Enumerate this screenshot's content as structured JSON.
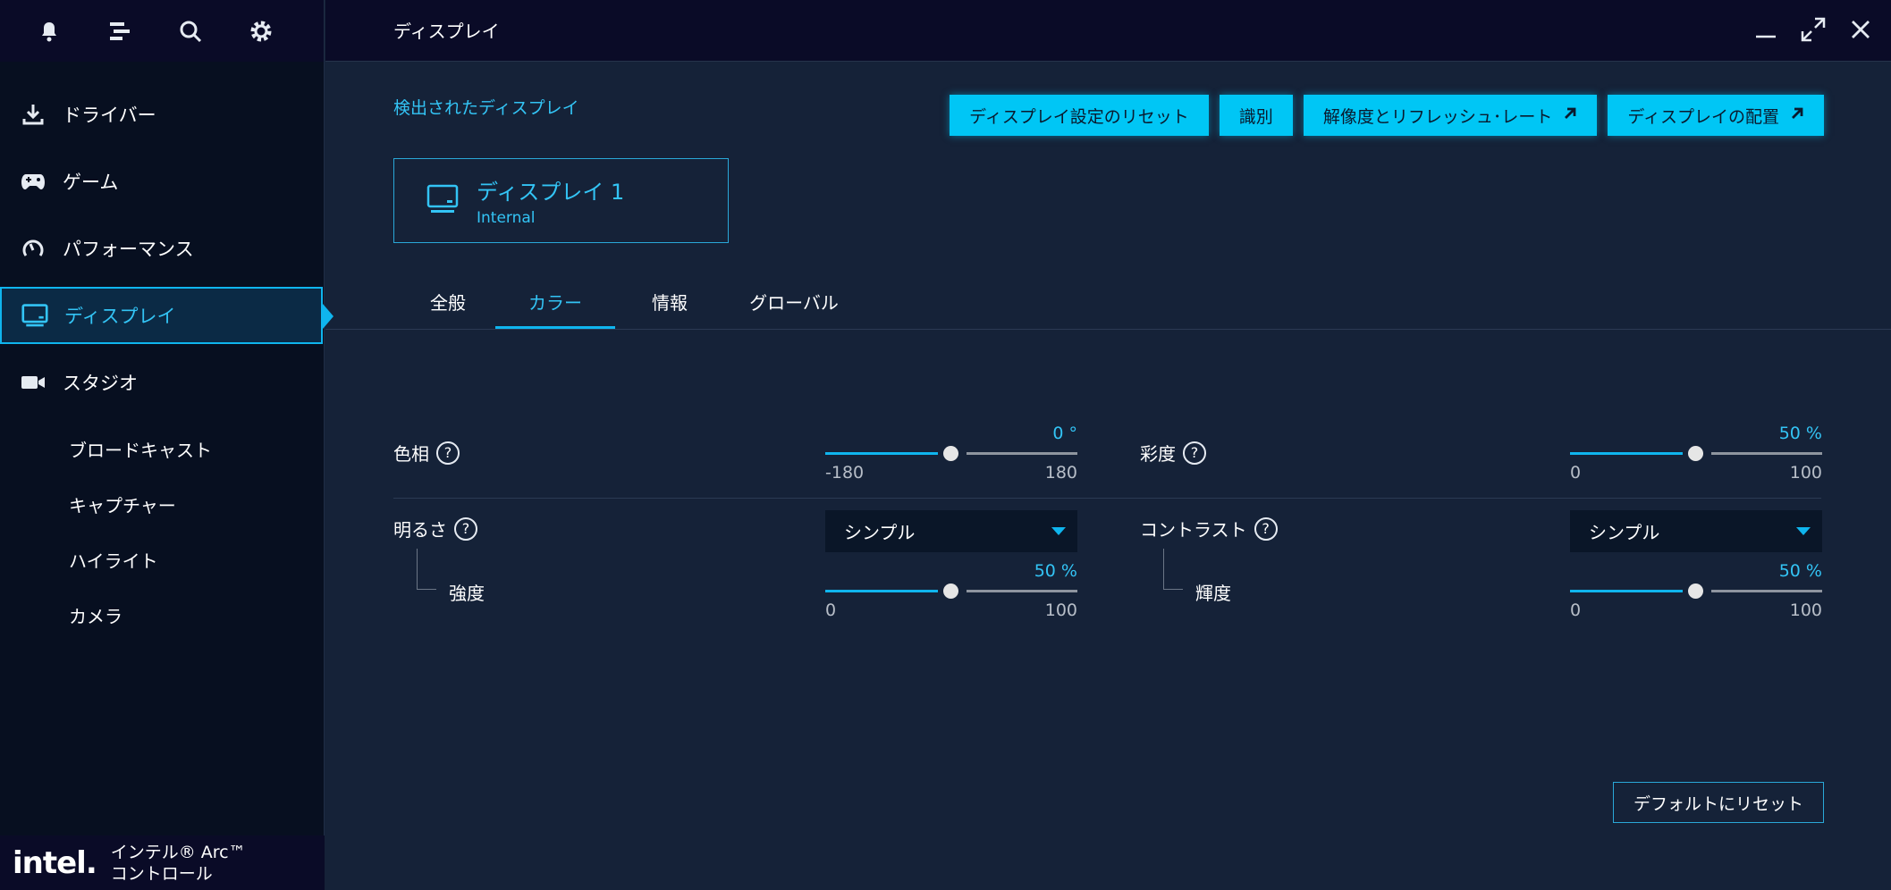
{
  "app": {
    "title": "ディスプレイ"
  },
  "brand": {
    "logo": "intel.",
    "line1": "インテル® Arc™",
    "line2": "コントロール"
  },
  "sidebar": {
    "top_icons": [
      "bell-icon",
      "list-icon",
      "search-icon",
      "gear-icon"
    ],
    "items": [
      {
        "label": "ドライバー",
        "icon": "download-icon"
      },
      {
        "label": "ゲーム",
        "icon": "gamepad-icon"
      },
      {
        "label": "パフォーマンス",
        "icon": "gauge-icon"
      },
      {
        "label": "ディスプレイ",
        "icon": "monitor-icon",
        "active": true
      },
      {
        "label": "スタジオ",
        "icon": "camera-icon"
      }
    ],
    "sub_items": [
      "ブロードキャスト",
      "キャプチャー",
      "ハイライト",
      "カメラ"
    ]
  },
  "header": {
    "detected_label": "検出されたディスプレイ",
    "buttons": [
      "ディスプレイ設定のリセット",
      "識別",
      "解像度とリフレッシュ･レート",
      "ディスプレイの配置"
    ]
  },
  "display_card": {
    "name": "ディスプレイ 1",
    "type": "Internal"
  },
  "tabs": [
    {
      "label": "全般"
    },
    {
      "label": "カラー",
      "active": true
    },
    {
      "label": "情報"
    },
    {
      "label": "グローバル"
    }
  ],
  "settings": {
    "hue": {
      "label": "色相",
      "value_text": "0 °",
      "value": 0,
      "min": "-180",
      "max": "180"
    },
    "saturation": {
      "label": "彩度",
      "value_text": "50 %",
      "value": 50,
      "min": "0",
      "max": "100"
    },
    "brightness": {
      "label": "明るさ",
      "mode": "シンプル",
      "sub_label": "強度",
      "value_text": "50 %",
      "value": 50,
      "min": "0",
      "max": "100"
    },
    "contrast": {
      "label": "コントラスト",
      "mode": "シンプル",
      "sub_label": "輝度",
      "value_text": "50 %",
      "value": 50,
      "min": "0",
      "max": "100"
    }
  },
  "footer": {
    "reset_default": "デフォルトにリセット"
  },
  "colors": {
    "accent": "#00c6f5",
    "sidebar_bg": "#070f20",
    "main_bg": "#152238"
  }
}
